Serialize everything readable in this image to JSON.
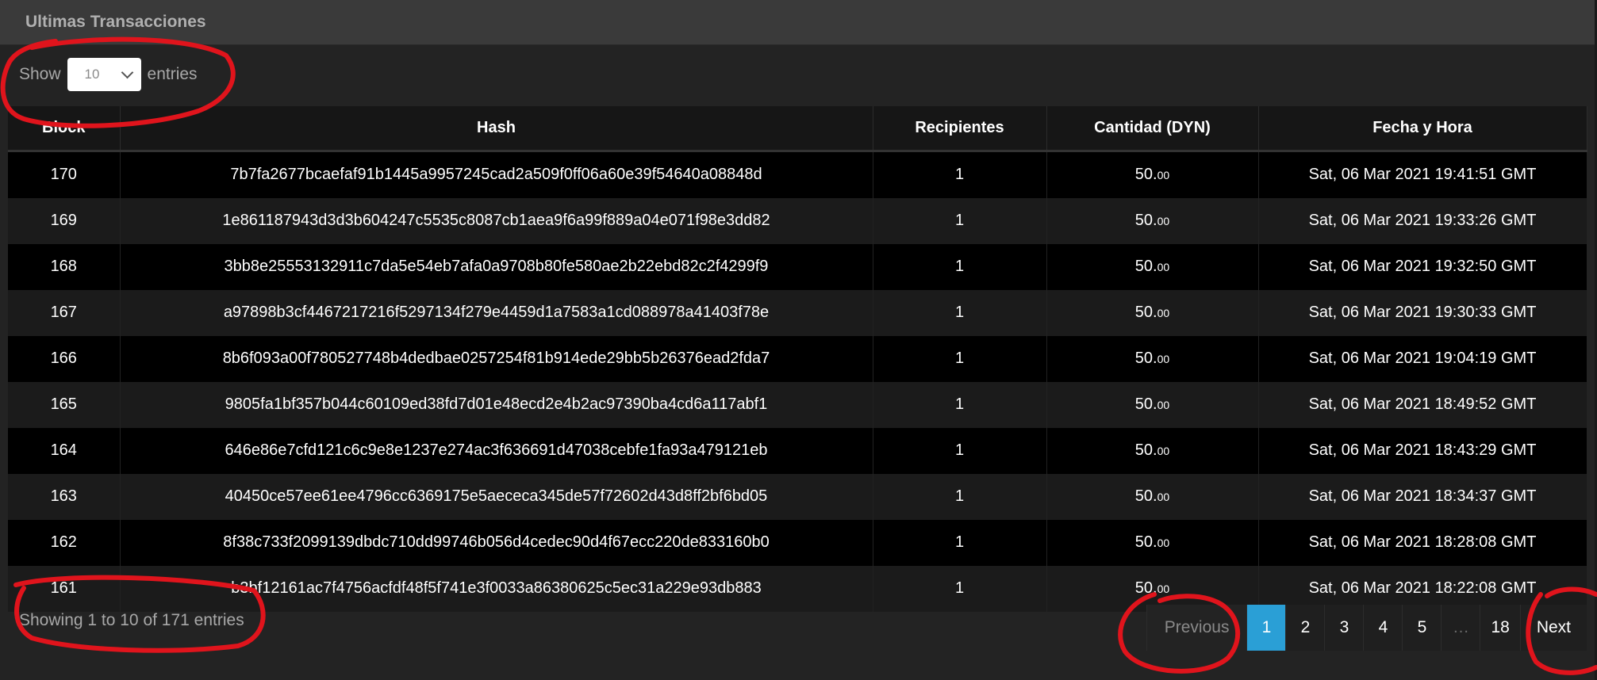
{
  "panel": {
    "title": "Ultimas Transacciones"
  },
  "length_menu": {
    "prefix": "Show",
    "selected": "10",
    "suffix": "entries"
  },
  "table": {
    "columns": [
      "Block",
      "Hash",
      "Recipientes",
      "Cantidad (DYN)",
      "Fecha y Hora"
    ],
    "rows": [
      {
        "block": "170",
        "hash": "7b7fa2677bcaefaf91b1445a9957245cad2a509f0ff06a60e39f54640a08848d",
        "recipients": "1",
        "amount_int": "50.",
        "amount_dec": "00",
        "datetime": "Sat, 06 Mar 2021 19:41:51 GMT"
      },
      {
        "block": "169",
        "hash": "1e861187943d3d3b604247c5535c8087cb1aea9f6a99f889a04e071f98e3dd82",
        "recipients": "1",
        "amount_int": "50.",
        "amount_dec": "00",
        "datetime": "Sat, 06 Mar 2021 19:33:26 GMT"
      },
      {
        "block": "168",
        "hash": "3bb8e25553132911c7da5e54eb7afa0a9708b80fe580ae2b22ebd82c2f4299f9",
        "recipients": "1",
        "amount_int": "50.",
        "amount_dec": "00",
        "datetime": "Sat, 06 Mar 2021 19:32:50 GMT"
      },
      {
        "block": "167",
        "hash": "a97898b3cf4467217216f5297134f279e4459d1a7583a1cd088978a41403f78e",
        "recipients": "1",
        "amount_int": "50.",
        "amount_dec": "00",
        "datetime": "Sat, 06 Mar 2021 19:30:33 GMT"
      },
      {
        "block": "166",
        "hash": "8b6f093a00f780527748b4dedbae0257254f81b914ede29bb5b26376ead2fda7",
        "recipients": "1",
        "amount_int": "50.",
        "amount_dec": "00",
        "datetime": "Sat, 06 Mar 2021 19:04:19 GMT"
      },
      {
        "block": "165",
        "hash": "9805fa1bf357b044c60109ed38fd7d01e48ecd2e4b2ac97390ba4cd6a117abf1",
        "recipients": "1",
        "amount_int": "50.",
        "amount_dec": "00",
        "datetime": "Sat, 06 Mar 2021 18:49:52 GMT"
      },
      {
        "block": "164",
        "hash": "646e86e7cfd121c6c9e8e1237e274ac3f636691d47038cebfe1fa93a479121eb",
        "recipients": "1",
        "amount_int": "50.",
        "amount_dec": "00",
        "datetime": "Sat, 06 Mar 2021 18:43:29 GMT"
      },
      {
        "block": "163",
        "hash": "40450ce57ee61ee4796cc6369175e5aececa345de57f72602d43d8ff2bf6bd05",
        "recipients": "1",
        "amount_int": "50.",
        "amount_dec": "00",
        "datetime": "Sat, 06 Mar 2021 18:34:37 GMT"
      },
      {
        "block": "162",
        "hash": "8f38c733f2099139dbdc710dd99746b056d4cedec90d4f67ecc220de833160b0",
        "recipients": "1",
        "amount_int": "50.",
        "amount_dec": "00",
        "datetime": "Sat, 06 Mar 2021 18:28:08 GMT"
      },
      {
        "block": "161",
        "hash": "b3bf12161ac7f4756acfdf48f5f741e3f0033a86380625c5ec31a229e93db883",
        "recipients": "1",
        "amount_int": "50.",
        "amount_dec": "00",
        "datetime": "Sat, 06 Mar 2021 18:22:08 GMT"
      }
    ]
  },
  "info_text": "Showing 1 to 10 of 171 entries",
  "pagination": {
    "previous": "Previous",
    "pages": [
      "1",
      "2",
      "3",
      "4",
      "5",
      "…",
      "18"
    ],
    "active": "1",
    "next": "Next"
  },
  "colors": {
    "accent": "#2a9fd6",
    "annotation": "#e0141c"
  }
}
